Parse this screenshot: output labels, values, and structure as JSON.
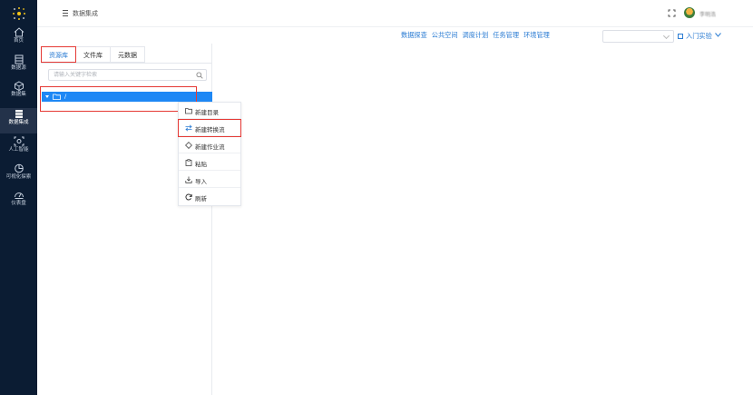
{
  "sidebar": {
    "items": [
      {
        "label": "首页",
        "icon": "home-icon"
      },
      {
        "label": "数据源",
        "icon": "database-icon"
      },
      {
        "label": "数据集",
        "icon": "dataset-icon"
      },
      {
        "label": "数据集成",
        "icon": "integration-icon",
        "active": true
      },
      {
        "label": "人工智能",
        "icon": "ai-icon"
      },
      {
        "label": "可视化探索",
        "icon": "chart-icon"
      },
      {
        "label": "仪表盘",
        "icon": "dashboard-icon"
      }
    ]
  },
  "header": {
    "title": "数据集成",
    "username": "李明浩",
    "links": [
      "数据探查",
      "公共空间",
      "调度计划",
      "任务管理",
      "环境管理"
    ],
    "project_select_value": "",
    "intro": "入门实验"
  },
  "left_panel": {
    "tabs": [
      "资源库",
      "文件库",
      "元数据"
    ],
    "active_tab": 0,
    "search_placeholder": "请输入关键字检索",
    "tree_root_label": "/"
  },
  "context_menu": {
    "items": [
      {
        "label": "新建目录",
        "icon": "folder-icon"
      },
      {
        "label": "新建转换流",
        "icon": "transform-icon",
        "selected": true
      },
      {
        "label": "新建作业流",
        "icon": "diamond-icon"
      },
      {
        "label": "粘贴",
        "icon": "paste-icon"
      },
      {
        "label": "导入",
        "icon": "import-icon"
      },
      {
        "label": "刷新",
        "icon": "refresh-icon"
      }
    ]
  },
  "colors": {
    "sidebar_bg": "#0b1c33",
    "accent": "#2b7cd3",
    "tree_selected": "#1e88f5",
    "highlight_red": "#e53935"
  }
}
